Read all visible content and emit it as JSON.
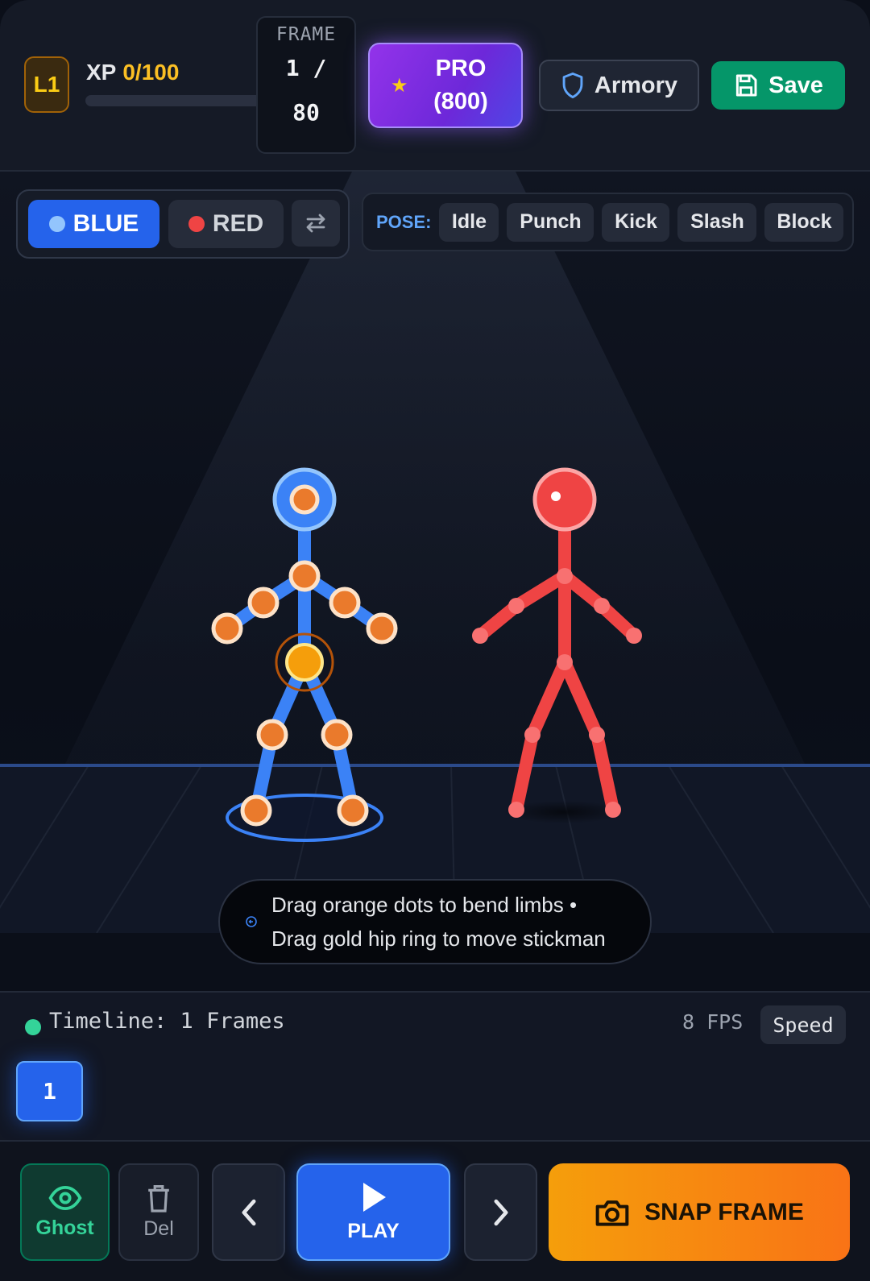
{
  "header": {
    "level_badge": "L1",
    "xp_label": "XP",
    "xp_value": "0/100",
    "xp_progress": 0,
    "frame_label": "FRAME",
    "frame_current": "1 /",
    "frame_total": "80",
    "pro_label": "PRO",
    "pro_price": "(800)",
    "armory_label": "Armory",
    "save_label": "Save"
  },
  "team_selector": {
    "blue_label": "BLUE",
    "red_label": "RED",
    "selected": "BLUE"
  },
  "poses": {
    "label": "POSE:",
    "items": [
      "Idle",
      "Punch",
      "Kick",
      "Slash",
      "Block"
    ]
  },
  "hint": {
    "line1": "Drag orange dots to bend limbs •",
    "line2": "Drag gold hip ring to move stickman"
  },
  "timeline": {
    "title": "Timeline: 1 Frames",
    "fps": "8 FPS",
    "speed_label": "Speed",
    "frames": [
      "1"
    ]
  },
  "controls": {
    "ghost_label": "Ghost",
    "delete_label": "Del",
    "play_label": "PLAY",
    "snap_label": "SNAP FRAME"
  },
  "colors": {
    "blue_team": "#3b82f6",
    "red_team": "#ef4444",
    "joint": "#ea7a2c",
    "hip_ring": "#f59e0b",
    "accent_green": "#059669"
  }
}
